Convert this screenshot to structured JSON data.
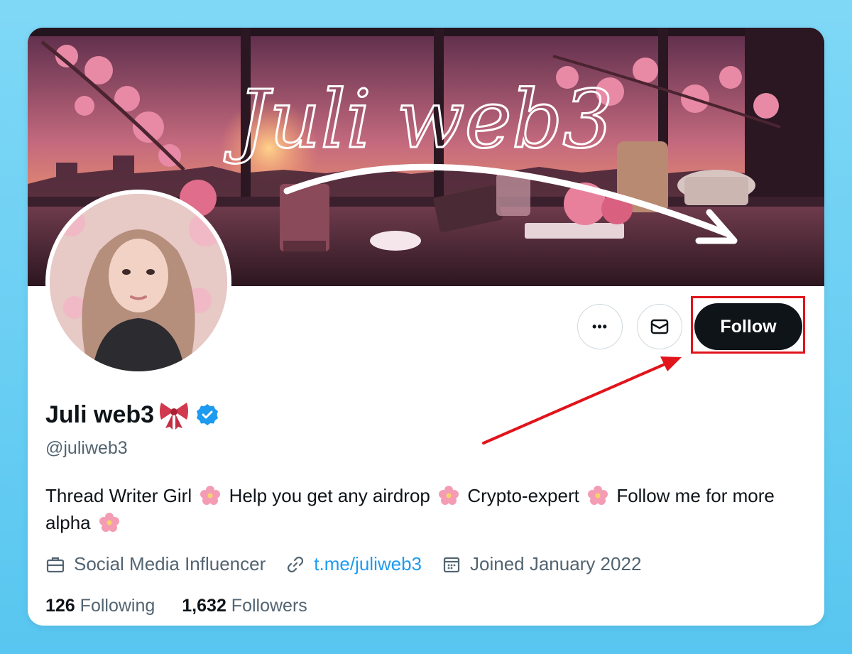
{
  "banner": {
    "title_script": "Juli web3"
  },
  "actions": {
    "more_label": "•••",
    "follow_label": "Follow"
  },
  "profile": {
    "name": "Juli web3",
    "handle": "@juliweb3",
    "bio_parts": [
      "Thread Writer Girl",
      "Help you get any airdrop",
      "Crypto-expert",
      "Follow me for more alpha"
    ],
    "profession": "Social Media Influencer",
    "link": "t.me/juliweb3",
    "joined": "Joined January 2022",
    "following_count": "126",
    "following_label": "Following",
    "followers_count": "1,632",
    "followers_label": "Followers"
  },
  "colors": {
    "accent": "#1d9bf0",
    "annotation": "#e1141b",
    "follow_bg": "#0f1419"
  }
}
